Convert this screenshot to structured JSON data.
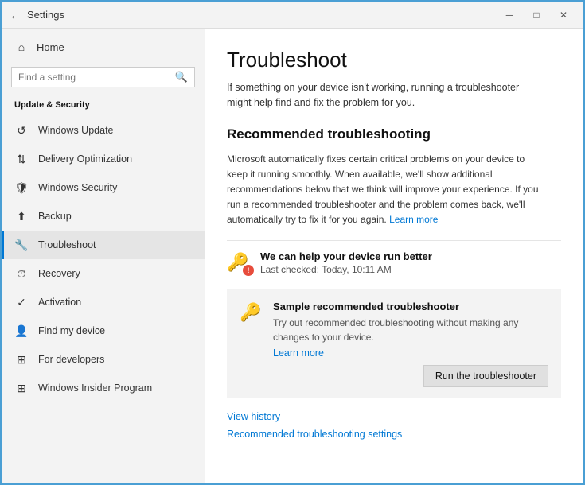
{
  "titlebar": {
    "back_icon": "←",
    "title": "Settings",
    "minimize_icon": "─",
    "maximize_icon": "□",
    "close_icon": "✕"
  },
  "sidebar": {
    "home_label": "Home",
    "search_placeholder": "Find a setting",
    "section_title": "Update & Security",
    "items": [
      {
        "id": "windows-update",
        "label": "Windows Update",
        "icon": "↺"
      },
      {
        "id": "delivery-optimization",
        "label": "Delivery Optimization",
        "icon": "⇅"
      },
      {
        "id": "windows-security",
        "label": "Windows Security",
        "icon": "🛡"
      },
      {
        "id": "backup",
        "label": "Backup",
        "icon": "⬆"
      },
      {
        "id": "troubleshoot",
        "label": "Troubleshoot",
        "icon": "🔧",
        "active": true
      },
      {
        "id": "recovery",
        "label": "Recovery",
        "icon": "⏱"
      },
      {
        "id": "activation",
        "label": "Activation",
        "icon": "✓"
      },
      {
        "id": "find-my-device",
        "label": "Find my device",
        "icon": "👤"
      },
      {
        "id": "for-developers",
        "label": "For developers",
        "icon": "⊞"
      },
      {
        "id": "windows-insider",
        "label": "Windows Insider Program",
        "icon": "⊞"
      }
    ]
  },
  "main": {
    "title": "Troubleshoot",
    "description": "If something on your device isn't working, running a troubleshooter might help find and fix the problem for you.",
    "recommended_title": "Recommended troubleshooting",
    "recommended_desc": "Microsoft automatically fixes certain critical problems on your device to keep it running smoothly. When available, we'll show additional recommendations below that we think will improve your experience. If you run a recommended troubleshooter and the problem comes back, we'll automatically try to fix it for you again.",
    "learn_more_link": "Learn more",
    "item1": {
      "title": "We can help your device run better",
      "subtitle": "Last checked: Today, 10:11 AM"
    },
    "item2": {
      "title": "Sample recommended troubleshooter",
      "desc": "Try out recommended troubleshooting without making any changes to your device.",
      "learn_more": "Learn more",
      "run_btn": "Run the troubleshooter"
    },
    "footer": {
      "view_history": "View history",
      "settings_link": "Recommended troubleshooting settings"
    }
  }
}
